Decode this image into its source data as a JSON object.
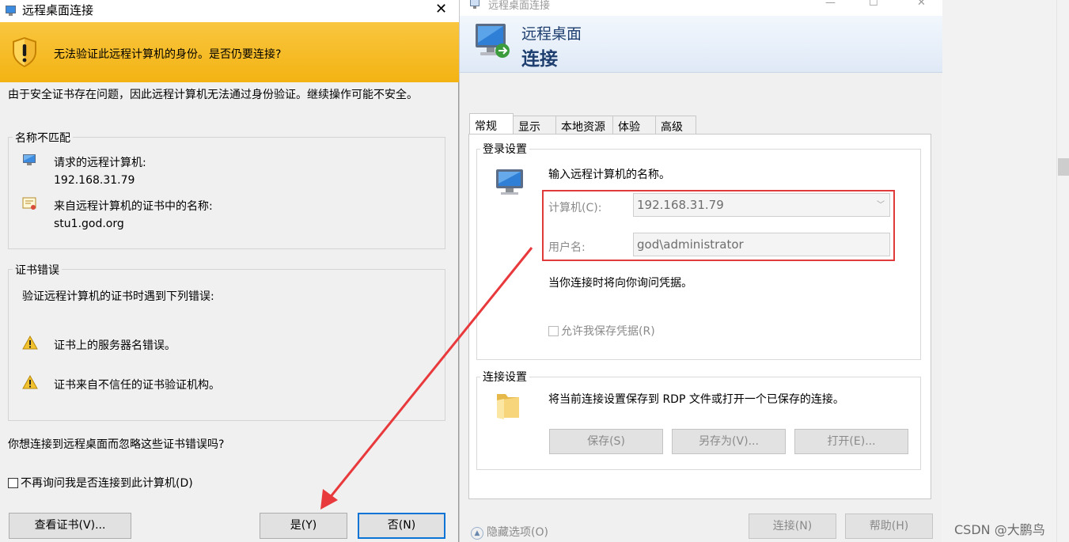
{
  "cert_dialog": {
    "title": "远程桌面连接",
    "close_label": "✕",
    "warning_banner": "无法验证此远程计算机的身份。是否仍要连接?",
    "intro_text": "由于安全证书存在问题，因此远程计算机无法通过身份验证。继续操作可能不安全。",
    "name_mismatch": {
      "label": "名称不匹配",
      "requested_label": "请求的远程计算机:",
      "requested_value": "192.168.31.79",
      "cert_name_label": "来自远程计算机的证书中的名称:",
      "cert_name_value": "stu1.god.org"
    },
    "cert_errors": {
      "label": "证书错误",
      "intro": "验证远程计算机的证书时遇到下列错误:",
      "items": [
        "证书上的服务器名错误。",
        "证书来自不信任的证书验证机构。"
      ]
    },
    "question": "你想连接到远程桌面而忽略这些证书错误吗?",
    "dont_ask_label": "不再询问我是否连接到此计算机(D)",
    "buttons": {
      "view_cert": "查看证书(V)...",
      "yes": "是(Y)",
      "no": "否(N)"
    }
  },
  "rdp_window": {
    "title": "远程桌面连接",
    "banner_line1": "远程桌面",
    "banner_line2": "连接",
    "tabs": [
      "常规",
      "显示",
      "本地资源",
      "体验",
      "高级"
    ],
    "login_settings": {
      "label": "登录设置",
      "prompt": "输入远程计算机的名称。",
      "computer_label": "计算机(C):",
      "computer_value": "192.168.31.79",
      "username_label": "用户名:",
      "username_value": "god\\administrator",
      "ask_credentials": "当你连接时将向你询问凭据。",
      "allow_save_label": "允许我保存凭据(R)"
    },
    "connection_settings": {
      "label": "连接设置",
      "description": "将当前连接设置保存到 RDP 文件或打开一个已保存的连接。",
      "buttons": [
        "保存(S)",
        "另存为(V)...",
        "打开(E)..."
      ]
    },
    "hide_options": "隐藏选项(O)",
    "connect_button": "连接(N)",
    "help_button": "帮助(H)"
  },
  "watermark": "CSDN @大鹏鸟",
  "colors": {
    "warning_banner": "#f5b921",
    "highlight_box": "#e03a3a",
    "arrow": "#e8393c",
    "default_button_border": "#0a74d6"
  }
}
